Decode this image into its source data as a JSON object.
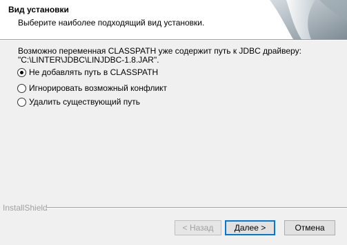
{
  "header": {
    "title": "Вид установки",
    "subtitle": "Выберите наиболее подходящий вид установки."
  },
  "message": {
    "line1": "Возможно переменная CLASSPATH уже содержит путь к JDBC драйверу:",
    "line2": "\"C:\\LINTER\\JDBC\\LINJDBC-1.8.JAR\"."
  },
  "options": [
    {
      "label": "Не добавлять путь в CLASSPATH",
      "selected": true
    },
    {
      "label": "Игнорировать возможный конфликт",
      "selected": false
    },
    {
      "label": "Удалить существующий путь",
      "selected": false
    }
  ],
  "footer": {
    "brand": "InstallShield"
  },
  "buttons": {
    "back": "< Назад",
    "next": "Далее >",
    "cancel": "Отмена"
  }
}
